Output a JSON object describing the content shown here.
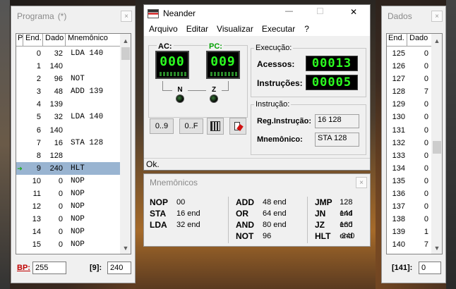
{
  "programa": {
    "title": "Programa",
    "modified": "(*)",
    "close": "×",
    "headers": [
      "P",
      "End.",
      "Dado",
      "Mnemônico"
    ],
    "rows": [
      {
        "end": "0",
        "dado": "32",
        "mn": "LDA 140"
      },
      {
        "end": "1",
        "dado": "140",
        "mn": ""
      },
      {
        "end": "2",
        "dado": "96",
        "mn": "NOT"
      },
      {
        "end": "3",
        "dado": "48",
        "mn": "ADD 139"
      },
      {
        "end": "4",
        "dado": "139",
        "mn": ""
      },
      {
        "end": "5",
        "dado": "32",
        "mn": "LDA 140"
      },
      {
        "end": "6",
        "dado": "140",
        "mn": ""
      },
      {
        "end": "7",
        "dado": "16",
        "mn": "STA 128"
      },
      {
        "end": "8",
        "dado": "128",
        "mn": ""
      },
      {
        "end": "9",
        "dado": "240",
        "mn": "HLT"
      },
      {
        "end": "10",
        "dado": "0",
        "mn": "NOP"
      },
      {
        "end": "11",
        "dado": "0",
        "mn": "NOP"
      },
      {
        "end": "12",
        "dado": "0",
        "mn": "NOP"
      },
      {
        "end": "13",
        "dado": "0",
        "mn": "NOP"
      },
      {
        "end": "14",
        "dado": "0",
        "mn": "NOP"
      },
      {
        "end": "15",
        "dado": "0",
        "mn": "NOP"
      }
    ],
    "selected_index": 9,
    "pointer": "➜",
    "bp_label": "BP:",
    "bp_value": "255",
    "pos_label": "[9]:",
    "pos_value": "240"
  },
  "neander": {
    "title": "Neander",
    "min": "—",
    "max": "☐",
    "close": "✕",
    "menu": [
      "Arquivo",
      "Editar",
      "Visualizar",
      "Executar",
      "?"
    ],
    "ac_label": "AC:",
    "ac_value": "000",
    "pc_label": "PC:",
    "pc_value": "009",
    "n_label": "N",
    "z_label": "Z",
    "exec_label": "Execução:",
    "acessos_label": "Acessos:",
    "acessos_value": "00013",
    "instr_label": "Instruções:",
    "instr_value": "00005",
    "instrucao_label": "Instrução:",
    "reg_label": "Reg.Instrução:",
    "reg_value": "16 128",
    "mnem_label": "Mnemônico:",
    "mnem_value": "STA 128",
    "btn_dec": "0..9",
    "btn_hex": "0..F",
    "status": "Ok."
  },
  "mnemonicos": {
    "title": "Mnemônicos",
    "close": "×",
    "cols": [
      [
        {
          "op": "NOP",
          "val": "00"
        },
        {
          "op": "STA",
          "val": "16 end"
        },
        {
          "op": "LDA",
          "val": "32 end"
        }
      ],
      [
        {
          "op": "ADD",
          "val": "48 end"
        },
        {
          "op": "OR",
          "val": "64 end"
        },
        {
          "op": "AND",
          "val": "80 end"
        },
        {
          "op": "NOT",
          "val": "96"
        }
      ],
      [
        {
          "op": "JMP",
          "val": "128 end"
        },
        {
          "op": "JN",
          "val": "144 end"
        },
        {
          "op": "JZ",
          "val": "160 end"
        },
        {
          "op": "HLT",
          "val": "240"
        }
      ]
    ]
  },
  "dados": {
    "title": "Dados",
    "close": "×",
    "headers": [
      "End.",
      "Dado"
    ],
    "rows": [
      {
        "end": "125",
        "dado": "0"
      },
      {
        "end": "126",
        "dado": "0"
      },
      {
        "end": "127",
        "dado": "0"
      },
      {
        "end": "128",
        "dado": "7"
      },
      {
        "end": "129",
        "dado": "0"
      },
      {
        "end": "130",
        "dado": "0"
      },
      {
        "end": "131",
        "dado": "0"
      },
      {
        "end": "132",
        "dado": "0"
      },
      {
        "end": "133",
        "dado": "0"
      },
      {
        "end": "134",
        "dado": "0"
      },
      {
        "end": "135",
        "dado": "0"
      },
      {
        "end": "136",
        "dado": "0"
      },
      {
        "end": "137",
        "dado": "0"
      },
      {
        "end": "138",
        "dado": "0"
      },
      {
        "end": "139",
        "dado": "1"
      },
      {
        "end": "140",
        "dado": "7"
      }
    ],
    "pos_label": "[141]:",
    "pos_value": "0"
  }
}
